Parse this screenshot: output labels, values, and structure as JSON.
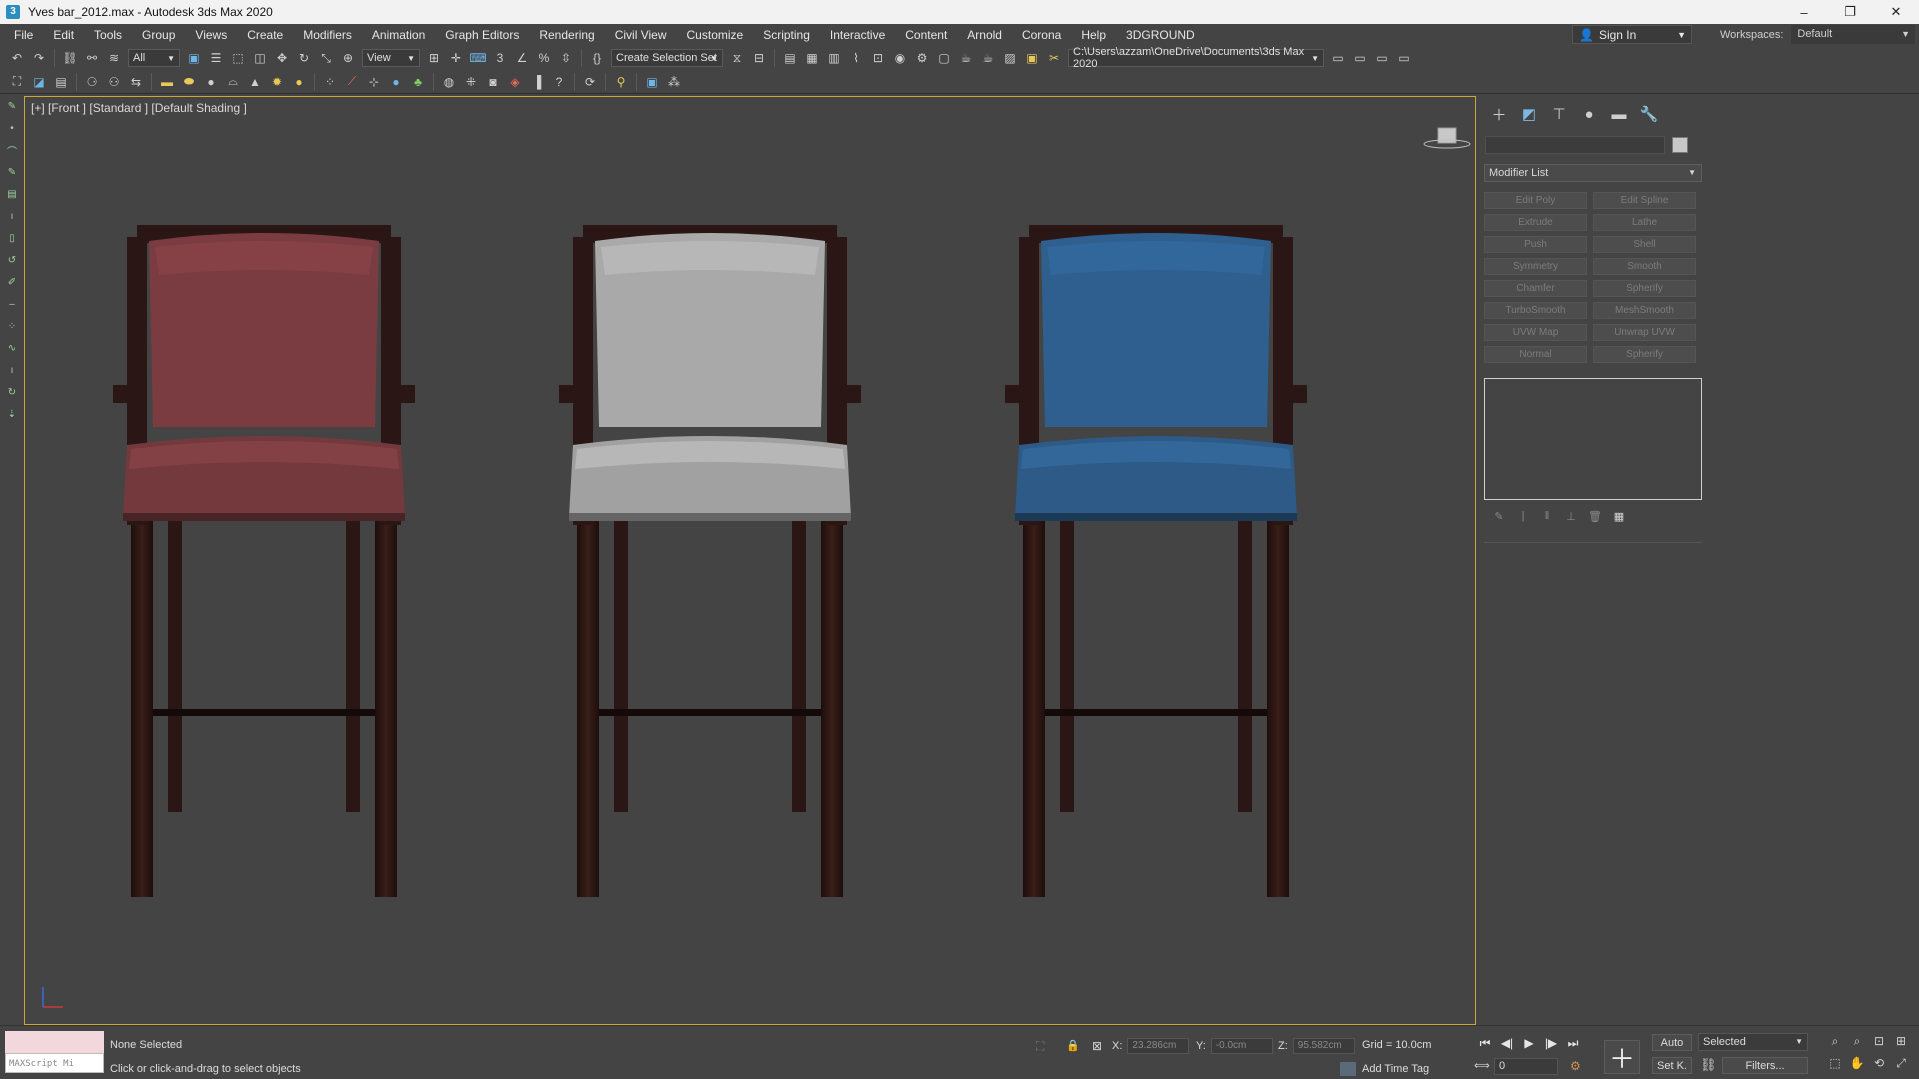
{
  "window": {
    "title": "Yves bar_2012.max - Autodesk 3ds Max 2020",
    "minimize": "–",
    "restore": "❐",
    "close": "✕"
  },
  "menu": [
    "File",
    "Edit",
    "Tools",
    "Group",
    "Views",
    "Create",
    "Modifiers",
    "Animation",
    "Graph Editors",
    "Rendering",
    "Civil View",
    "Customize",
    "Scripting",
    "Interactive",
    "Content",
    "Arnold",
    "Corona",
    "Help",
    "3DGROUND"
  ],
  "account": {
    "sign_in": "Sign In",
    "workspaces_label": "Workspaces:",
    "workspace_value": "Default"
  },
  "toolbar": {
    "selection_filter": "All",
    "reference_coord": "View",
    "named_selection": "Create Selection Set",
    "project_path": "C:\\Users\\azzam\\OneDrive\\Documents\\3ds Max 2020"
  },
  "viewport": {
    "label": "[+] [Front ] [Standard ] [Default Shading ]",
    "chair_colors": [
      "#7a3c40",
      "#a9a9a9",
      "#2f5f8e"
    ],
    "frame_color": "#2a1614"
  },
  "command_panel": {
    "modifier_list": "Modifier List",
    "modifiers": [
      "Edit Poly",
      "Edit Spline",
      "Extrude",
      "Lathe",
      "Push",
      "Shell",
      "Symmetry",
      "Smooth",
      "Chamfer",
      "Spherify",
      "TurboSmooth",
      "MeshSmooth",
      "UVW Map",
      "Unwrap UVW",
      "Normal",
      "Spherify"
    ]
  },
  "status": {
    "maxscript_label": "MAXScript Mi",
    "selection": "None Selected",
    "prompt": "Click or click-and-drag to select objects",
    "x_label": "X:",
    "x_value": "23.286cm",
    "y_label": "Y:",
    "y_value": "-0.0cm",
    "z_label": "Z:",
    "z_value": "95.582cm",
    "grid": "Grid = 10.0cm",
    "add_time_tag": "Add Time Tag",
    "frame": "0",
    "auto_key": "Auto",
    "set_key": "Set K.",
    "key_filter_value": "Selected",
    "filters": "Filters..."
  }
}
